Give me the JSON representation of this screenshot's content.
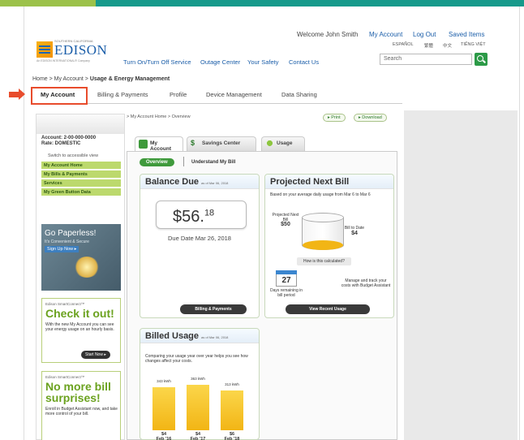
{
  "colors": {
    "accent_green": "#9cc24a",
    "brand_teal": "#179a8b",
    "brand_blue": "#1b5ea9",
    "highlight_red": "#e84c2c",
    "bar_yellow": "#f2b515"
  },
  "logo": {
    "tagline": "SOUTHERN CALIFORNIA",
    "name": "EDISON",
    "subline": "An EDISON INTERNATIONAL® Company"
  },
  "header": {
    "welcome": "Welcome John Smith",
    "util_links": [
      "My Account",
      "Log Out",
      "Saved Items"
    ],
    "languages": [
      "ESPAÑOL",
      "繁體",
      "中文",
      "TIẾNG VIỆT"
    ],
    "search_placeholder": "Search",
    "nav": [
      "Turn On/Turn Off Service",
      "Outage Center",
      "Your Safety",
      "Contact Us"
    ]
  },
  "breadcrumb": {
    "path": "Home > My Account > ",
    "current": "Usage & Energy Management"
  },
  "tabs": [
    "My Account",
    "Billing & Payments",
    "Profile",
    "Device Management",
    "Data Sharing"
  ],
  "sidebar": {
    "account_line": "Account: 2-00-000-0000",
    "rate_line": "Rate: DOMESTIC",
    "switch_text": "Switch to accessible view",
    "items": [
      "My Account Home",
      "My Bills & Payments",
      "Services",
      "My Green Button Data"
    ]
  },
  "promos": {
    "paperless": {
      "title": "Go Paperless!",
      "subtitle": "It's Convenient & Secure",
      "button": "Sign Up Now ▸"
    },
    "checkit": {
      "kicker": "Edison SmartConnect™",
      "heading": "Check it out!",
      "text": "With the new My Account you can see your energy usage on an hourly basis.",
      "button": "Start Now ▸"
    },
    "surprises": {
      "kicker": "Edison SmartConnect™",
      "heading": "No more bill surprises!",
      "text": "Enroll in Budget Assistant now, and take more control of your bill."
    }
  },
  "content": {
    "sub_breadcrumb": "> My Account Home > Overview",
    "print_label": "Print",
    "download_label": "Download",
    "panel_tabs": [
      "My Account",
      "Savings Center",
      "Usage"
    ],
    "sub_tabs": [
      "Overview",
      "Understand My Bill"
    ],
    "balance": {
      "title": "Balance Due",
      "as_of": "as of Mar 06, 2018",
      "dollars": "$56.",
      "cents": "18",
      "due_label": "Due Date",
      "due_date": "Mar 26, 2018",
      "button": "Billing & Payments"
    },
    "projected": {
      "title": "Projected Next Bill",
      "text": "Based on your average daily usage from Mar 6 to Mar 6",
      "proj_label": "Projected Next Bill",
      "proj_value": "$50",
      "todate_label": "Bill to Date",
      "todate_value": "$4",
      "how": "How is this calculated?",
      "days": "27",
      "days_label": "Days remaining in bill period",
      "manage_text": "Manage and track your costs with Budget Assistant",
      "button": "View Recent Usage"
    },
    "billed": {
      "title": "Billed Usage",
      "as_of": "as of Mar 06, 2018",
      "text": "Comparing your usage year over year helps you see how changes affect your costs."
    }
  },
  "chart_data": {
    "type": "bar",
    "categories": [
      "Feb '16",
      "Feb '17",
      "Feb '18"
    ],
    "values": [
      343,
      363,
      313
    ],
    "value_labels": [
      "343 kWh",
      "363 kWh",
      "313 kWh"
    ],
    "cost_labels": [
      "$4",
      "$4",
      "$6"
    ],
    "title": "Billed Usage"
  }
}
